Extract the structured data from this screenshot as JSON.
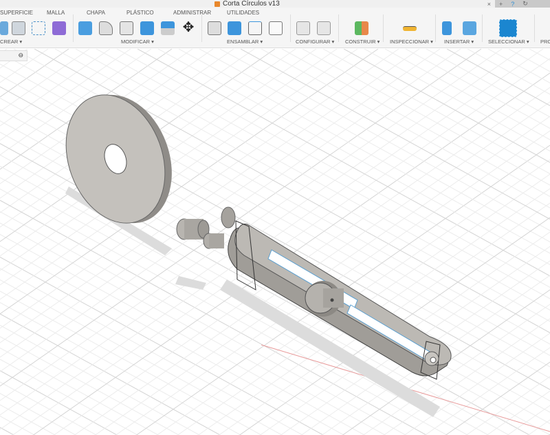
{
  "window": {
    "title": "Corta Círculos v13",
    "close": "×",
    "new_tab": "+",
    "help": "?",
    "refresh": "↻"
  },
  "tabs": [
    "SUPERFICIE",
    "MALLA",
    "CHAPA",
    "PLÁSTICO",
    "ADMINISTRAR",
    "UTILIDADES"
  ],
  "groups": [
    {
      "label": "CREAR ▾"
    },
    {
      "label": "MODIFICAR ▾"
    },
    {
      "label": "ENSAMBLAR ▾"
    },
    {
      "label": "CONFIGURAR ▾"
    },
    {
      "label": "CONSTRUIR ▾"
    },
    {
      "label": "INSPECCIONAR ▾"
    },
    {
      "label": "INSERTAR ▾"
    },
    {
      "label": "SELECCIONAR ▾"
    },
    {
      "label": "PRO"
    }
  ],
  "browser": {
    "collapse": "⊖"
  },
  "colors": {
    "accent": "#2b8fd6",
    "axis_red": "#e07070",
    "grid": "#e2e2e2",
    "model": "#b9b6b1"
  }
}
